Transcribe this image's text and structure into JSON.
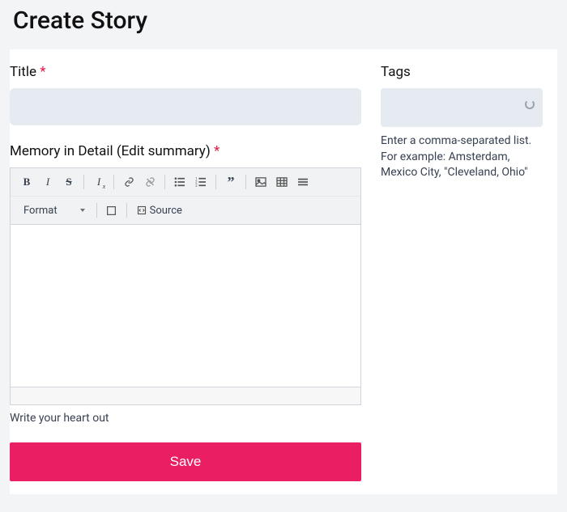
{
  "page_title": "Create Story",
  "title_field": {
    "label": "Title",
    "required": "*",
    "value": ""
  },
  "tags_field": {
    "label": "Tags",
    "value": "",
    "help": "Enter a comma-separated list. For example: Amsterdam, Mexico City, \"Cleveland, Ohio\""
  },
  "memory_field": {
    "label": "Memory in Detail (Edit summary)",
    "required": "*",
    "hint": "Write your heart out"
  },
  "toolbar": {
    "format_label": "Format",
    "source_label": "Source"
  },
  "save_label": "Save"
}
